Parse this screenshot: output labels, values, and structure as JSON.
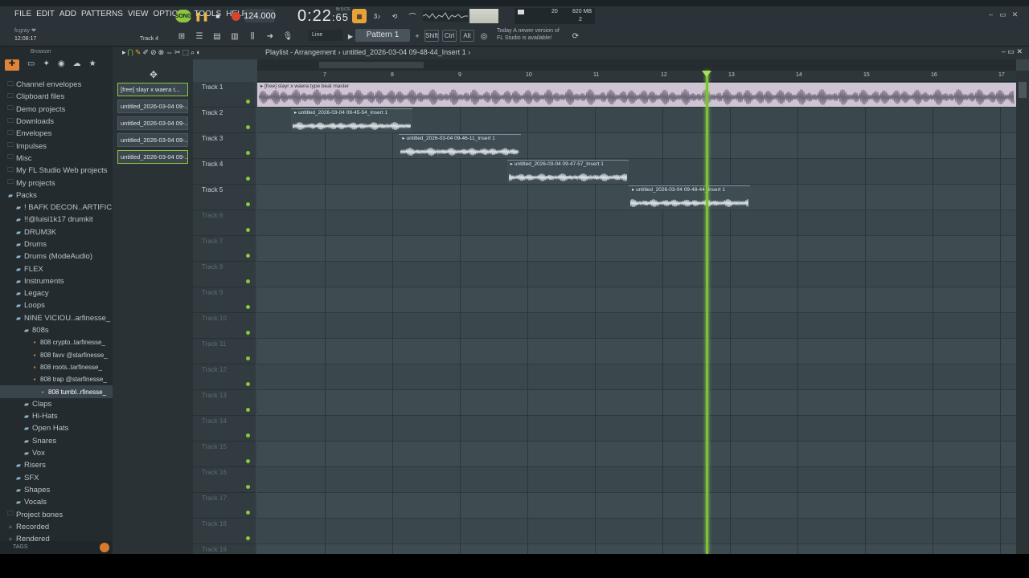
{
  "menu": [
    "FILE",
    "EDIT",
    "ADD",
    "PATTERNS",
    "VIEW",
    "OPTIONS",
    "TOOLS",
    "HELP"
  ],
  "song_mode_label": "SONG",
  "tempo": "124.000",
  "time_main": "0:22",
  "time_sub": ":65",
  "time_unit": "M:S:CS",
  "hint_user": "fcgray ❤",
  "clock": "12:08:17",
  "track_hint": "Track 4",
  "cpu": "20",
  "mem": "820 MB",
  "voices": "2",
  "snap_mode": "Line",
  "pattern_name": "Pattern 1",
  "modifiers": [
    "Shift",
    "Ctrl",
    "Alt"
  ],
  "news_line1": "Today  A newer version of",
  "news_line2": "FL Studio is available!",
  "browser_title": "Browser",
  "browser": [
    {
      "icon": "folder",
      "label": "Channel envelopes",
      "indent": 1
    },
    {
      "icon": "folder",
      "label": "Clipboard files",
      "indent": 1
    },
    {
      "icon": "folder",
      "label": "Demo projects",
      "indent": 1
    },
    {
      "icon": "folder",
      "label": "Downloads",
      "indent": 1
    },
    {
      "icon": "folder",
      "label": "Envelopes",
      "indent": 1
    },
    {
      "icon": "folder",
      "label": "Impulses",
      "indent": 1
    },
    {
      "icon": "folder",
      "label": "Misc",
      "indent": 1
    },
    {
      "icon": "folder",
      "label": "My FL Studio Web projects",
      "indent": 1
    },
    {
      "icon": "folder",
      "label": "My projects",
      "indent": 1
    },
    {
      "icon": "pack",
      "label": "Packs",
      "indent": 1
    },
    {
      "icon": "pack",
      "label": "! BAFK DECON..ARTIFICIAL",
      "indent": 2
    },
    {
      "icon": "pack",
      "label": "!!@luisi1k17 drumkit",
      "indent": 2
    },
    {
      "icon": "pack",
      "label": "DRUM3K",
      "indent": 2
    },
    {
      "icon": "pack",
      "label": "Drums",
      "indent": 2
    },
    {
      "icon": "pack",
      "label": "Drums (ModeAudio)",
      "indent": 2
    },
    {
      "icon": "pack",
      "label": "FLEX",
      "indent": 2
    },
    {
      "icon": "pack",
      "label": "Instruments",
      "indent": 2
    },
    {
      "icon": "pack",
      "label": "Legacy",
      "indent": 2
    },
    {
      "icon": "pack",
      "label": "Loops",
      "indent": 2
    },
    {
      "icon": "pack",
      "label": "NINE VICIOU..arfinesse_",
      "indent": 2
    },
    {
      "icon": "pack",
      "label": "808s",
      "indent": 3
    },
    {
      "icon": "file",
      "label": "808 crypto..tarfinesse_",
      "indent": 4
    },
    {
      "icon": "file",
      "label": "808 favv @starfinesse_",
      "indent": 4
    },
    {
      "icon": "file",
      "label": "808 roots..tarfinesse_",
      "indent": 4
    },
    {
      "icon": "file",
      "label": "808 trap @starfinesse_",
      "indent": 4
    },
    {
      "icon": "file",
      "label": "808 tumbl..rfinesse_",
      "indent": 5
    },
    {
      "icon": "pack",
      "label": "Claps",
      "indent": 3
    },
    {
      "icon": "pack",
      "label": "Hi-Hats",
      "indent": 3
    },
    {
      "icon": "pack",
      "label": "Open Hats",
      "indent": 3
    },
    {
      "icon": "pack",
      "label": "Snares",
      "indent": 3
    },
    {
      "icon": "pack",
      "label": "Vox",
      "indent": 3
    },
    {
      "icon": "pack",
      "label": "Risers",
      "indent": 2
    },
    {
      "icon": "pack",
      "label": "SFX",
      "indent": 2
    },
    {
      "icon": "pack",
      "label": "Shapes",
      "indent": 2
    },
    {
      "icon": "pack",
      "label": "Vocals",
      "indent": 2
    },
    {
      "icon": "folder",
      "label": "Project bones",
      "indent": 1
    },
    {
      "icon": "plus",
      "label": "Recorded",
      "indent": 1
    },
    {
      "icon": "plus",
      "label": "Rendered",
      "indent": 1
    }
  ],
  "browser_tags": "TAGS",
  "patterns": [
    "[free] slayr x waera t...",
    "untitled_2026-03-04 09-...",
    "untitled_2026-03-04 09-...",
    "untitled_2026-03-04 09-...",
    "untitled_2026-03-04 09-..."
  ],
  "playlist_title": "Playlist - Arrangement",
  "playlist_crumb": "untitled_2026-03-04 09-48-44_Insert 1",
  "ruler": [
    "7",
    "8",
    "9",
    "10",
    "11",
    "12",
    "13",
    "14",
    "15",
    "16",
    "17"
  ],
  "tracks": [
    "Track 1",
    "Track 2",
    "Track 3",
    "Track 4",
    "Track 5",
    "Track 6",
    "Track 7",
    "Track 8",
    "Track 9",
    "Track 10",
    "Track 11",
    "Track 12",
    "Track 13",
    "Track 14",
    "Track 15",
    "Track 16",
    "Track 17",
    "Track 18",
    "Track 19"
  ],
  "clips": [
    {
      "track": 0,
      "start_bar": 6.0,
      "end_bar": 17.5,
      "label": "[free] slayr x waera type beat  master",
      "master": true
    },
    {
      "track": 1,
      "start_bar": 6.5,
      "end_bar": 8.3,
      "label": "untitled_2026-03-04 09-45-54_Insert 1"
    },
    {
      "track": 2,
      "start_bar": 8.1,
      "end_bar": 9.9,
      "label": "untitled_2026-03-04 09-46-11_Insert 1"
    },
    {
      "track": 3,
      "start_bar": 9.7,
      "end_bar": 11.5,
      "label": "untitled_2026-03-04 09-47-57_Insert 1"
    },
    {
      "track": 4,
      "start_bar": 11.5,
      "end_bar": 13.3,
      "label": "untitled_2026-03-04 09-48-44_Insert 1"
    }
  ],
  "playhead_bar": 12.65,
  "colors": {
    "accent": "#8cc63f",
    "playhead": "#79c335",
    "record": "#d9442b",
    "browser_highlight": "#e0843a"
  }
}
